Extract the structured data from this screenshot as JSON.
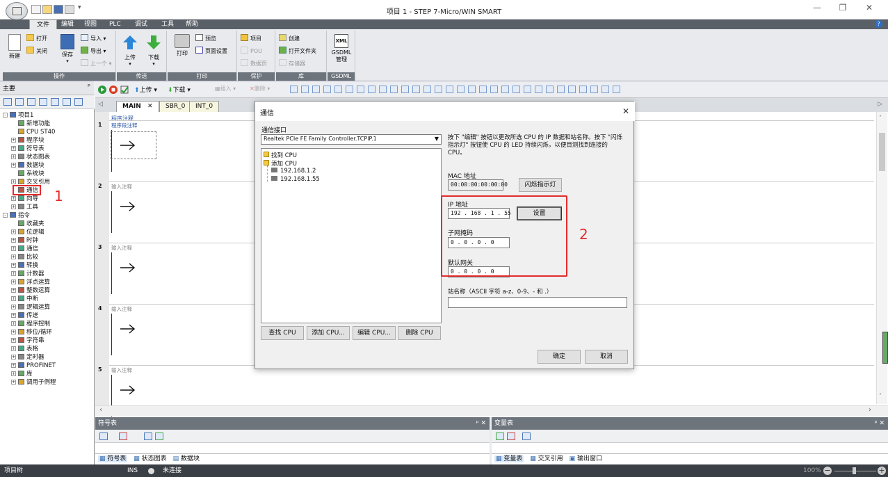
{
  "window": {
    "title": "项目 1 - STEP 7-Micro/WIN SMART"
  },
  "menu": [
    "文件",
    "编辑",
    "视图",
    "PLC",
    "调试",
    "工具",
    "帮助"
  ],
  "ribbon": {
    "groups": [
      {
        "name": "操作",
        "buttons": {
          "new": "新建",
          "open": "打开",
          "close": "关闭",
          "save": "保存",
          "import": "导入",
          "export": "导出",
          "prev": "上一个"
        }
      },
      {
        "name": "传送",
        "buttons": {
          "upload": "上传",
          "download": "下载"
        }
      },
      {
        "name": "打印",
        "buttons": {
          "print": "打印",
          "preview": "预览",
          "page_setup": "页面设置"
        }
      },
      {
        "name": "保护",
        "buttons": {
          "project": "项目",
          "pou": "POU",
          "datapage": "数据页"
        }
      },
      {
        "name": "库",
        "buttons": {
          "create": "创建",
          "open_folder": "打开文件夹",
          "memory": "存储器"
        }
      },
      {
        "name": "GSDML",
        "buttons": {
          "xml": "XML",
          "gsdml": "GSDML",
          "manage": "管理"
        }
      }
    ]
  },
  "left_panel": {
    "title": "主要",
    "pin": "ᵖ",
    "tree": [
      {
        "label": "项目1",
        "level": 0,
        "exp": "-"
      },
      {
        "label": "新增功能",
        "level": 1
      },
      {
        "label": "CPU ST40",
        "level": 1
      },
      {
        "label": "程序块",
        "level": 1,
        "exp": "+"
      },
      {
        "label": "符号表",
        "level": 1,
        "exp": "+"
      },
      {
        "label": "状态图表",
        "level": 1,
        "exp": "+"
      },
      {
        "label": "数据块",
        "level": 1,
        "exp": "+"
      },
      {
        "label": "系统块",
        "level": 1
      },
      {
        "label": "交叉引用",
        "level": 1,
        "exp": "+"
      },
      {
        "label": "通信",
        "level": 1
      },
      {
        "label": "向导",
        "level": 1,
        "exp": "+"
      },
      {
        "label": "工具",
        "level": 1,
        "exp": "+"
      },
      {
        "label": "指令",
        "level": 0,
        "exp": "-"
      },
      {
        "label": "收藏夹",
        "level": 1
      },
      {
        "label": "位逻辑",
        "level": 1,
        "exp": "+"
      },
      {
        "label": "时钟",
        "level": 1,
        "exp": "+"
      },
      {
        "label": "通信",
        "level": 1,
        "exp": "+"
      },
      {
        "label": "比较",
        "level": 1,
        "exp": "+"
      },
      {
        "label": "转换",
        "level": 1,
        "exp": "+"
      },
      {
        "label": "计数器",
        "level": 1,
        "exp": "+"
      },
      {
        "label": "浮点运算",
        "level": 1,
        "exp": "+"
      },
      {
        "label": "整数运算",
        "level": 1,
        "exp": "+"
      },
      {
        "label": "中断",
        "level": 1,
        "exp": "+"
      },
      {
        "label": "逻辑运算",
        "level": 1,
        "exp": "+"
      },
      {
        "label": "传送",
        "level": 1,
        "exp": "+"
      },
      {
        "label": "程序控制",
        "level": 1,
        "exp": "+"
      },
      {
        "label": "移位/循环",
        "level": 1,
        "exp": "+"
      },
      {
        "label": "字符串",
        "level": 1,
        "exp": "+"
      },
      {
        "label": "表格",
        "level": 1,
        "exp": "+"
      },
      {
        "label": "定时器",
        "level": 1,
        "exp": "+"
      },
      {
        "label": "PROFINET",
        "level": 1,
        "exp": "+"
      },
      {
        "label": "库",
        "level": 1,
        "exp": "+"
      },
      {
        "label": "调用子例程",
        "level": 1,
        "exp": "+"
      }
    ]
  },
  "annotations": {
    "one": "1",
    "two": "2"
  },
  "editor": {
    "toolbar": {
      "upload": "上传",
      "download": "下载",
      "insert": "插入",
      "delete": "删除"
    },
    "tabs": [
      {
        "label": "MAIN",
        "active": true
      },
      {
        "label": "SBR_0"
      },
      {
        "label": "INT_0"
      }
    ],
    "program_comment": "程序注释",
    "networks": [
      {
        "num": "1",
        "comment": "程序段注释"
      },
      {
        "num": "2",
        "comment": "输入注释"
      },
      {
        "num": "3",
        "comment": "输入注释"
      },
      {
        "num": "4",
        "comment": "输入注释"
      },
      {
        "num": "5",
        "comment": "输入注释"
      }
    ]
  },
  "dialog": {
    "title": "通信",
    "interface_label": "通信接口",
    "interface_value": "Realtek PCIe FE Family Controller.TCPIP.1",
    "tree": {
      "found": "找到 CPU",
      "added": "添加 CPU",
      "items": [
        "192.168.1.2",
        "192.168.1.55"
      ]
    },
    "info": "按下 \"编辑\" 按钮以更改所选 CPU 的 IP 数据和站名称。按下 \"闪烁指示灯\" 按钮使 CPU 的 LED 持续闪烁，以便目测找到连接的 CPU。",
    "mac_label": "MAC 地址",
    "mac_value": "00:00:00:00:00:00",
    "blink_button": "闪烁指示灯",
    "ip_label": "IP 地址",
    "ip_value": "192 . 168 . 1 . 55",
    "set_button": "设置",
    "subnet_label": "子网掩码",
    "subnet_value": "0 . 0 . 0 . 0",
    "gateway_label": "默认网关",
    "gateway_value": "0 . 0 . 0 . 0",
    "station_label": "站名称（ASCII 字符 a-z、0-9、- 和 .）",
    "station_value": "",
    "buttons": {
      "find": "查找 CPU",
      "add": "添加 CPU...",
      "edit": "编辑 CPU...",
      "delete": "删除 CPU",
      "ok": "确定",
      "cancel": "取消"
    }
  },
  "bottom": {
    "left_title": "符号表",
    "right_title": "变量表",
    "left_tabs": [
      "符号表",
      "状态图表",
      "数据块"
    ],
    "right_tabs": [
      "变量表",
      "交叉引用",
      "输出窗口"
    ],
    "pin": "ᵖ ✕"
  },
  "status": {
    "left": "项目树",
    "ins": "INS",
    "conn": "未连接",
    "zoom": "100%"
  }
}
